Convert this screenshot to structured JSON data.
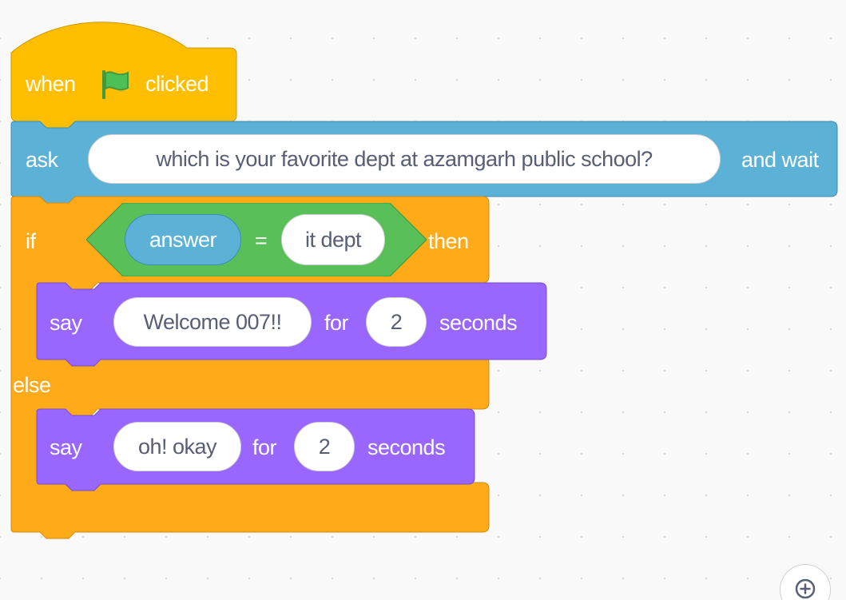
{
  "script": {
    "hat": {
      "when_label": "when",
      "flag_icon": "green-flag-icon",
      "clicked_label": "clicked",
      "color": "#ffbf00"
    },
    "ask": {
      "label": "ask",
      "question": "which is your favorite dept at azamgarh public school?",
      "wait_label": "and wait",
      "color": "#5cb1d6"
    },
    "if_else": {
      "if_label": "if",
      "condition": {
        "reporter": "answer",
        "operator": "=",
        "value": "it dept",
        "color": "#59c059"
      },
      "then_label": "then",
      "else_label": "else",
      "color": "#ffab19"
    },
    "say_then": {
      "say_label": "say",
      "message": "Welcome 007!!",
      "for_label": "for",
      "seconds_value": "2",
      "seconds_label": "seconds",
      "color": "#9966ff"
    },
    "say_else": {
      "say_label": "say",
      "message": "oh! okay",
      "for_label": "for",
      "seconds_value": "2",
      "seconds_label": "seconds",
      "color": "#9966ff"
    }
  },
  "controls": {
    "zoom_in_icon": "zoom-in-icon"
  }
}
